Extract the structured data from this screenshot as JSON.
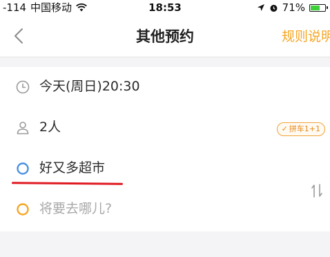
{
  "status_bar": {
    "signal": "-114",
    "carrier": "中国移动",
    "time": "18:53",
    "battery": "71%",
    "battery_level": 0.71
  },
  "nav": {
    "title": "其他预约",
    "rules_label": "规则说明"
  },
  "form": {
    "time_value": "今天(周日)20:30",
    "passengers_value": "2人",
    "carpool_badge": "拼车1+1",
    "origin_value": "好又多超市",
    "destination_placeholder": "将要去哪儿?"
  },
  "colors": {
    "accent": "#f5a623",
    "origin_dot": "#4a90e2",
    "destination_dot": "#f5a623",
    "annotation_underline": "#e01a22"
  },
  "icons": {
    "back": "chevron-left-icon",
    "clock": "clock-icon",
    "person": "person-icon",
    "origin": "origin-circle-icon",
    "destination": "destination-circle-icon",
    "swap": "swap-icon",
    "wifi": "wifi-icon",
    "location": "location-arrow-icon",
    "alarm": "alarm-icon"
  }
}
